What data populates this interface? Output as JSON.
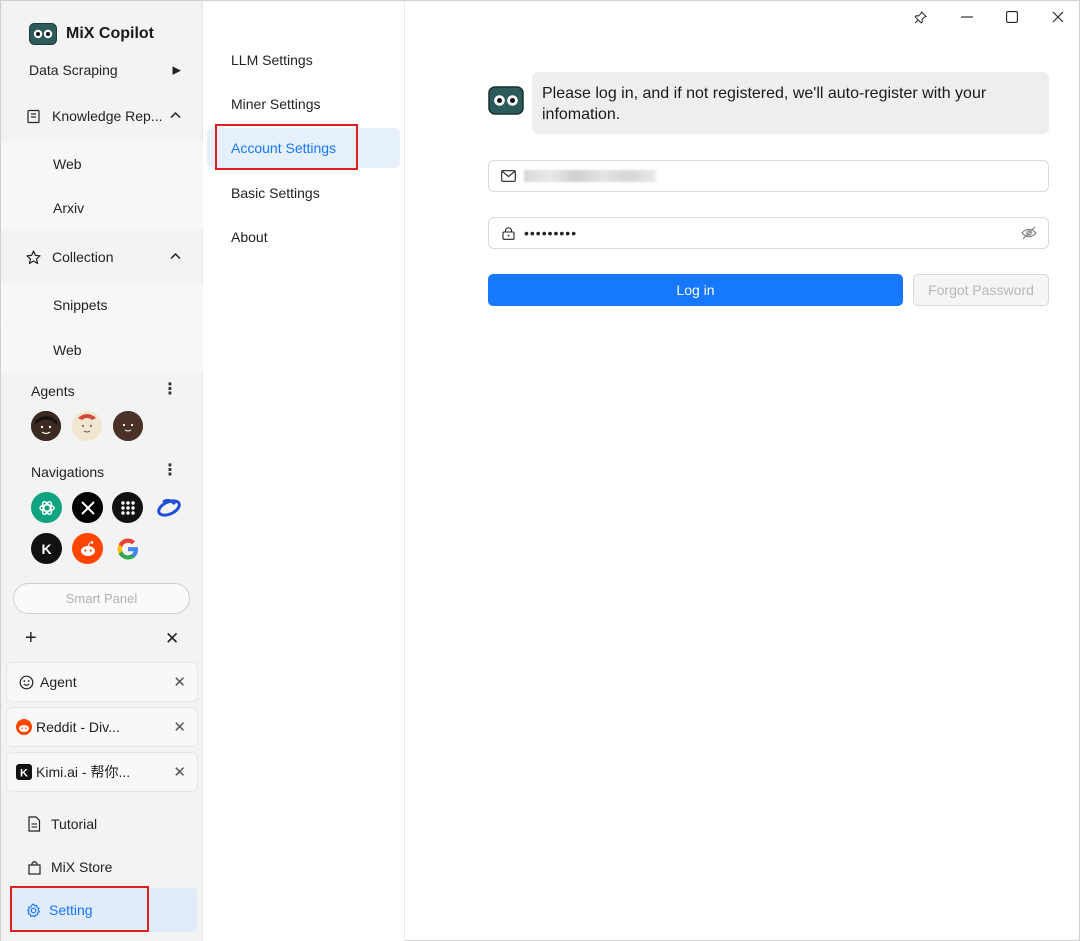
{
  "app": {
    "name": "MiX Copilot"
  },
  "window_controls": {
    "pin": "pin-icon",
    "minimize": "minimize-icon",
    "maximize": "maximize-icon",
    "close": "close-icon"
  },
  "sidebar": {
    "data_scraping": "Data Scraping",
    "knowledge_repo": {
      "label": "Knowledge Rep...",
      "children": [
        "Web",
        "Arxiv"
      ]
    },
    "collection": {
      "label": "Collection",
      "children": [
        "Snippets",
        "Web"
      ]
    },
    "agents_label": "Agents",
    "navigations_label": "Navigations",
    "navigation_icons": [
      "chatgpt-icon",
      "x-icon",
      "grid-app-icon",
      "blue-ring-icon",
      "kimi-icon",
      "reddit-icon",
      "google-icon"
    ],
    "smart_panel": "Smart Panel",
    "tabs": [
      {
        "label": "Agent",
        "icon": "smiley-icon"
      },
      {
        "label": "Reddit - Div...",
        "icon": "reddit-icon"
      },
      {
        "label": "Kimi.ai - 帮你...",
        "icon": "kimi-icon"
      }
    ],
    "tutorial": "Tutorial",
    "store": "MiX Store",
    "setting": "Setting"
  },
  "settings_nav": {
    "items": [
      "LLM Settings",
      "Miner Settings",
      "Account Settings",
      "Basic Settings",
      "About"
    ],
    "active": "Account Settings"
  },
  "account": {
    "message": "Please log in, and if not registered, we'll auto-register with your infomation.",
    "email_masked": "",
    "password_value": "•••••••••",
    "login_button": "Log in",
    "forgot_button": "Forgot Password"
  },
  "colors": {
    "accent": "#1677ff",
    "annotation": "#e02020"
  }
}
